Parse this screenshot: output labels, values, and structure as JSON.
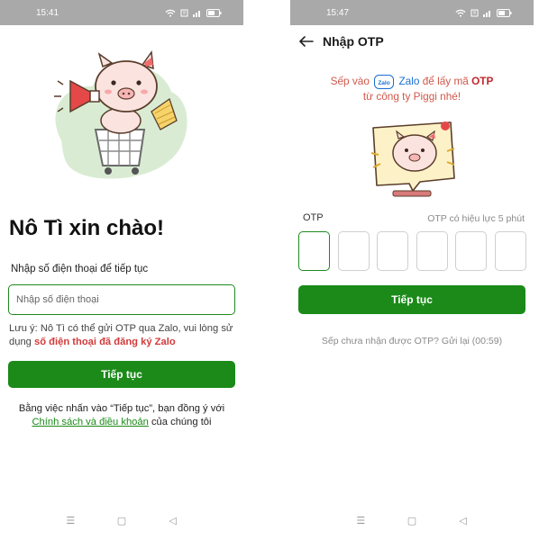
{
  "login_screen": {
    "status": {
      "time": "15:41"
    },
    "greeting": "Nô Tì xin chào!",
    "phone_label": "Nhập số điện thoại để tiếp tục",
    "phone_placeholder": "Nhập số điện thoại",
    "note_prefix": "Lưu ý: Nô Tì có thể gửi OTP qua Zalo, vui lòng sử dụng",
    "note_highlight": "số điện thoại đã đăng ký Zalo",
    "continue_label": "Tiếp tục",
    "terms_text": "Bằng việc nhấn vào “Tiếp tục”, bạn đồng ý với",
    "terms_link": "Chính sách và điều khoản",
    "terms_suffix": "của chúng tôi"
  },
  "otp_screen": {
    "status": {
      "time": "15:47"
    },
    "title": "Nhập OTP",
    "instruction_1": "Sếp vào",
    "zalo_logo_text": "Zalo",
    "zalo_word": "Zalo",
    "instruction_2": "để lấy mã",
    "instruction_otp": "OTP",
    "instruction_3": "từ công ty Piggi nhé!",
    "otp_label": "OTP",
    "otp_validity": "OTP có hiệu lực 5 phút",
    "continue_label": "Tiếp tục",
    "resend_text": "Sếp chưa nhận được OTP?  Gửi lại (00:59)",
    "otp_digits": [
      "",
      "",
      "",
      "",
      "",
      ""
    ]
  },
  "navbar": {
    "menu_glyph": "☰",
    "home_glyph": "▢",
    "back_glyph": "◁"
  },
  "colors": {
    "primary_green": "#1b8a19",
    "status_bar": "#a9a9a9",
    "accent_red": "#d13a3a",
    "zalo_blue": "#1a6fd3",
    "blob_green": "#d9ecd3"
  },
  "icons": [
    "wifi-icon",
    "sim-icon",
    "signal-icon",
    "battery-icon",
    "back-arrow-icon",
    "zalo-logo-icon",
    "pig-megaphone-illustration",
    "pig-chat-illustration"
  ]
}
